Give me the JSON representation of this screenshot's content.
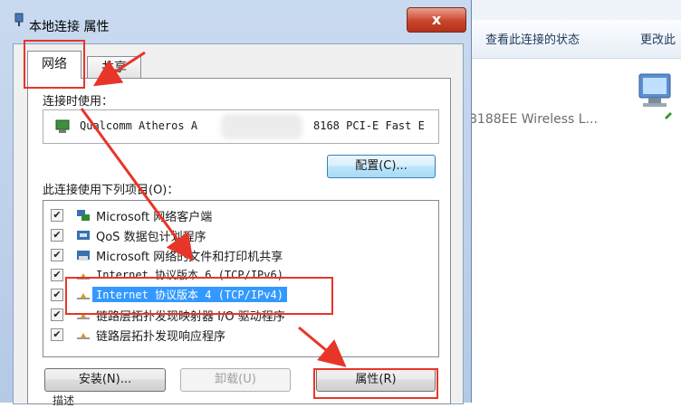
{
  "background_window": {
    "toolbar_items": [
      "查看此连接的状态",
      "更改此"
    ],
    "adapter_label": "8188EE Wireless L..."
  },
  "dialog": {
    "title": "本地连接 属性",
    "close_label": "x",
    "tabs": [
      {
        "label": "网络",
        "active": true
      },
      {
        "label": "共享",
        "active": false
      }
    ],
    "connect_using_label": "连接时使用：",
    "adapter_name_left": "Qualcomm Atheros A",
    "adapter_name_right": "8168 PCI-E Fast E",
    "config_button": "配置(C)...",
    "items_label": "此连接使用下列项目(O)：",
    "items": [
      {
        "text": "Microsoft 网络客户端",
        "checked": true,
        "icon": "network-client-icon",
        "selected": false
      },
      {
        "text": "QoS 数据包计划程序",
        "checked": true,
        "icon": "qos-icon",
        "selected": false
      },
      {
        "text": "Microsoft 网络的文件和打印机共享",
        "checked": true,
        "icon": "file-printer-share-icon",
        "selected": false
      },
      {
        "text": "Internet 协议版本 6 (TCP/IPv6)",
        "checked": true,
        "icon": "protocol-icon",
        "selected": false
      },
      {
        "text": "Internet 协议版本 4 (TCP/IPv4)",
        "checked": true,
        "icon": "protocol-icon",
        "selected": true
      },
      {
        "text": "链路层拓扑发现映射器 I/O 驱动程序",
        "checked": true,
        "icon": "protocol-icon",
        "selected": false
      },
      {
        "text": "链路层拓扑发现响应程序",
        "checked": true,
        "icon": "protocol-icon",
        "selected": false
      }
    ],
    "install_button": "安装(N)...",
    "uninstall_button": "卸载(U)",
    "properties_button": "属性(R)",
    "description_partial": "描述"
  },
  "annotation_color": "#e8352a",
  "selection_color": "#3399ff"
}
